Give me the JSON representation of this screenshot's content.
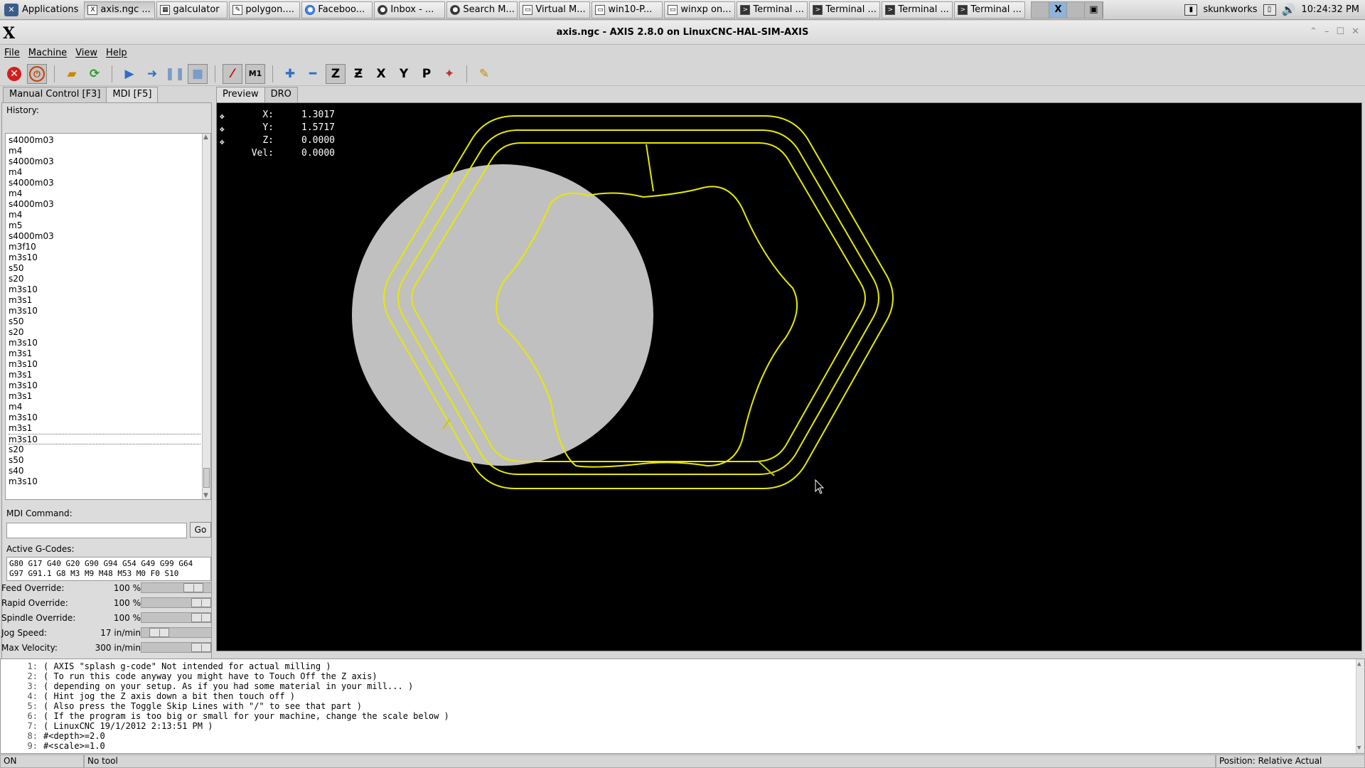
{
  "taskbar": {
    "apps_label": "Applications",
    "tasks": [
      {
        "label": "axis.ngc ...",
        "icon": "x-icon"
      },
      {
        "label": "galculator",
        "icon": "calculator-icon"
      },
      {
        "label": "polygon....",
        "icon": "editor-icon"
      },
      {
        "label": "Faceboo...",
        "icon": "chrome-icon"
      },
      {
        "label": "Inbox - ...",
        "icon": "github-icon"
      },
      {
        "label": "Search M...",
        "icon": "github-icon"
      },
      {
        "label": "Virtual M...",
        "icon": "vm-icon"
      },
      {
        "label": "win10-P...",
        "icon": "vm-icon"
      },
      {
        "label": "winxp on...",
        "icon": "vm-icon"
      },
      {
        "label": "Terminal ...",
        "icon": "terminal-icon"
      },
      {
        "label": "Terminal ...",
        "icon": "terminal-icon"
      },
      {
        "label": "Terminal ...",
        "icon": "terminal-icon"
      },
      {
        "label": "Terminal ...",
        "icon": "terminal-icon"
      }
    ],
    "user": "skunkworks",
    "clock": "10:24:32 PM"
  },
  "window": {
    "title": "axis.ngc - AXIS 2.8.0 on LinuxCNC-HAL-SIM-AXIS"
  },
  "menu": [
    "File",
    "Machine",
    "View",
    "Help"
  ],
  "toolbar_icons": [
    "estop-icon",
    "power-icon",
    "open-icon",
    "reload-icon",
    "run-icon",
    "step-icon",
    "pause-icon",
    "stop-icon",
    "block-delete-icon",
    "optional-stop-icon",
    "zoom-in-icon",
    "zoom-out-icon",
    "view-z-icon",
    "view-z2-icon",
    "view-x-icon",
    "view-y-icon",
    "view-p-icon",
    "rotate-view-icon",
    "clear-plot-icon"
  ],
  "left_tabs": {
    "manual": "Manual Control [F3]",
    "mdi": "MDI [F5]"
  },
  "mdi": {
    "history_label": "History:",
    "history": [
      "s4000m03",
      "m4",
      "s4000m03",
      "m4",
      "s4000m03",
      "m4",
      "s4000m03",
      "m4",
      "m5",
      "s4000m03",
      "m3f10",
      "m3s10",
      "s50",
      "s20",
      "m3s10",
      "m3s1",
      "m3s10",
      "s50",
      "s20",
      "m3s10",
      "m3s1",
      "m3s10",
      "m3s1",
      "m3s10",
      "m3s1",
      "m4",
      "m3s10",
      "m3s1",
      "m3s10",
      "s20",
      "s50",
      "s40",
      "m3s10"
    ],
    "selected_index": 28,
    "command_label": "MDI Command:",
    "command_value": "",
    "go_label": "Go",
    "gcodes_label": "Active G-Codes:",
    "gcodes_line1": "G80 G17 G40 G20 G90 G94 G54 G49 G99 G64",
    "gcodes_line2": "G97 G91.1 G8 M3 M9 M48 M53 M0 F0 S10"
  },
  "overrides": [
    {
      "name": "Feed Override:",
      "value": "100 %",
      "level": 0.84
    },
    {
      "name": "Rapid Override:",
      "value": "100 %",
      "level": 1.0
    },
    {
      "name": "Spindle Override:",
      "value": "100 %",
      "level": 1.0
    },
    {
      "name": "Jog Speed:",
      "value": "17 in/min",
      "level": 0.16
    },
    {
      "name": "Max Velocity:",
      "value": "300 in/min",
      "level": 1.0
    }
  ],
  "preview_tabs": {
    "preview": "Preview",
    "dro": "DRO"
  },
  "dro": [
    {
      "axis": "X:",
      "value": "1.3017"
    },
    {
      "axis": "Y:",
      "value": "1.5717"
    },
    {
      "axis": "Z:",
      "value": "0.0000"
    },
    {
      "axis": "Vel:",
      "value": "0.0000"
    }
  ],
  "colors": {
    "toolpath": "#e8e800",
    "toolpath_dim": "#c8c800",
    "tool": "#c0c0c0",
    "background": "#000000"
  },
  "listing": [
    {
      "n": "1:",
      "text": "( AXIS \"splash g-code\" Not intended for actual milling )"
    },
    {
      "n": "2:",
      "text": "( To run this code anyway you might have to Touch Off the Z axis)"
    },
    {
      "n": "3:",
      "text": "( depending on your setup. As if you had some material in your mill... )"
    },
    {
      "n": "4:",
      "text": "( Hint jog the Z axis down a bit then touch off )"
    },
    {
      "n": "5:",
      "text": "( Also press the Toggle Skip Lines with \"/\" to see that part )"
    },
    {
      "n": "6:",
      "text": "( If the program is too big or small for your machine, change the scale below )"
    },
    {
      "n": "7:",
      "text": "( LinuxCNC 19/1/2012 2:13:51 PM )"
    },
    {
      "n": "8:",
      "text": "#<depth>=2.0"
    },
    {
      "n": "9:",
      "text": "#<scale>=1.0"
    }
  ],
  "status": {
    "state": "ON",
    "tool": "No tool",
    "position": "Position: Relative Actual"
  }
}
